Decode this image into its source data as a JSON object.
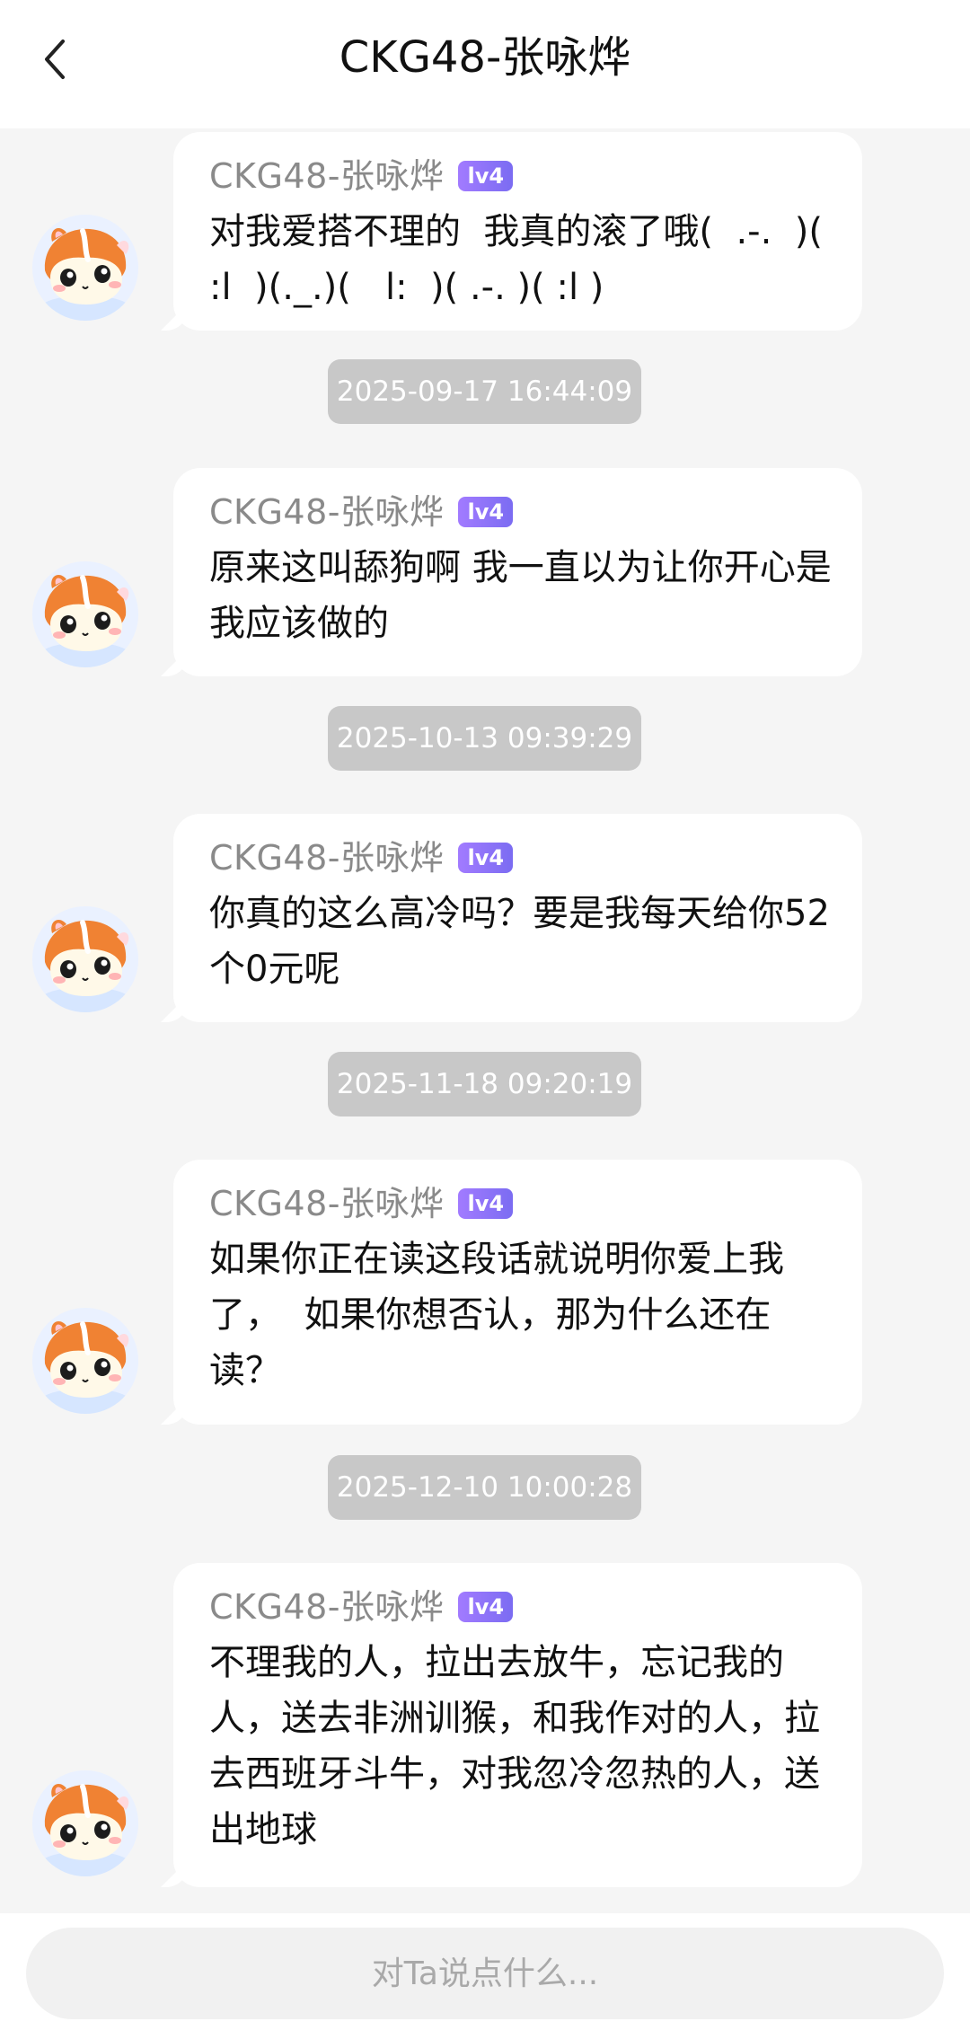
{
  "header": {
    "title": "CKG48-张咏烨",
    "back_icon": "chevron-left-icon"
  },
  "messages": [
    {
      "sender": "CKG48-张咏烨",
      "level": "lv4",
      "text": "对我爱搭不理的  我真的滚了哦(  .-.  )(   :l  )(._.)(   l:  )( .-. )( :l )"
    },
    {
      "sender": "CKG48-张咏烨",
      "level": "lv4",
      "text": "原来这叫舔狗啊 我一直以为让你开心是我应该做的"
    },
    {
      "sender": "CKG48-张咏烨",
      "level": "lv4",
      "text": "你真的这么高冷吗？要是我每天给你52个0元呢"
    },
    {
      "sender": "CKG48-张咏烨",
      "level": "lv4",
      "text": "如果你正在读这段话就说明你爱上我了，  如果你想否认，那为什么还在读？"
    },
    {
      "sender": "CKG48-张咏烨",
      "level": "lv4",
      "text": "不理我的人，拉出去放牛，忘记我的人，送去非洲训猴，和我作对的人，拉去西班牙斗牛，对我忽冷忽热的人，送出地球"
    }
  ],
  "timestamps": [
    "2025-09-17 16:44:09",
    "2025-10-13 09:39:29",
    "2025-11-18 09:20:19",
    "2025-12-10 10:00:28"
  ],
  "input": {
    "placeholder": "对Ta说点什么..."
  },
  "colors": {
    "background": "#f5f5f5",
    "bubble": "#ffffff",
    "badge_start": "#a27bff",
    "badge_end": "#7b6cf2",
    "timestamp_bg": "#c8c8c8"
  }
}
